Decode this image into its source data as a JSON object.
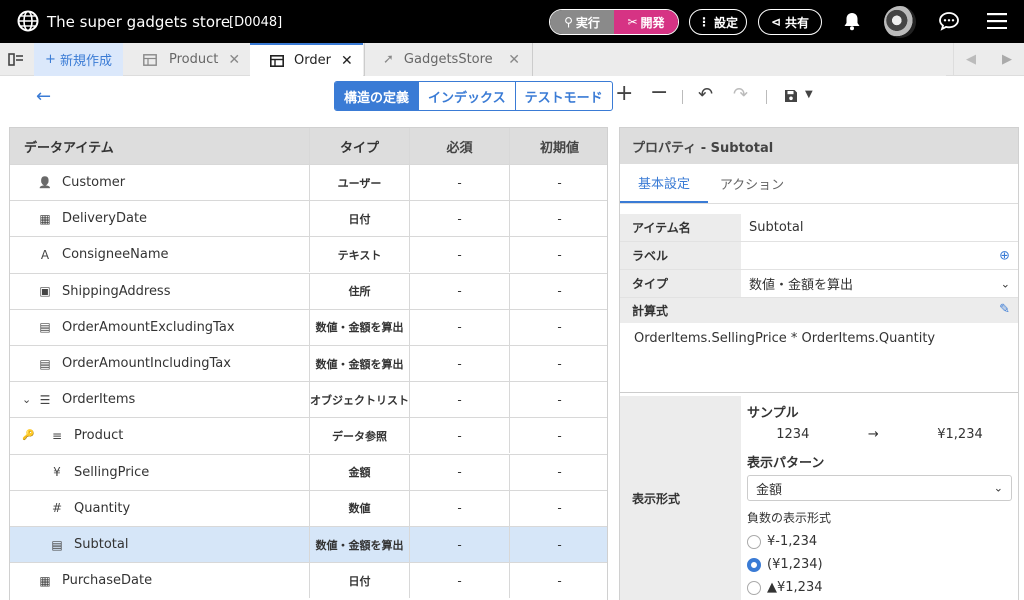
{
  "app": {
    "title": "The super gadgets store",
    "id": "[D0048]"
  },
  "header": {
    "run_label": "実行",
    "dev_label": "開発",
    "settings_label": "設定",
    "share_label": "共有"
  },
  "tabs": {
    "new_label": "新規作成",
    "items": [
      {
        "label": "Product",
        "active": false
      },
      {
        "label": "Order",
        "active": true
      },
      {
        "label": "GadgetsStore",
        "active": false
      }
    ]
  },
  "toolbar": {
    "segments": [
      "構造の定義",
      "インデックス",
      "テストモード"
    ],
    "active_segment": "構造の定義"
  },
  "grid": {
    "columns": [
      "データアイテム",
      "タイプ",
      "必須",
      "初期値"
    ],
    "rows": [
      {
        "name": "Customer",
        "type": "ユーザー",
        "required": "-",
        "default": "-",
        "icon": "user-icon",
        "level": 0
      },
      {
        "name": "DeliveryDate",
        "type": "日付",
        "required": "-",
        "default": "-",
        "icon": "calendar-icon",
        "level": 0
      },
      {
        "name": "ConsigneeName",
        "type": "テキスト",
        "required": "-",
        "default": "-",
        "icon": "text-icon",
        "level": 0
      },
      {
        "name": "ShippingAddress",
        "type": "住所",
        "required": "-",
        "default": "-",
        "icon": "address-icon",
        "level": 0
      },
      {
        "name": "OrderAmountExcludingTax",
        "type": "数値・金額を算出",
        "required": "-",
        "default": "-",
        "icon": "calculator-icon",
        "level": 0
      },
      {
        "name": "OrderAmountIncludingTax",
        "type": "数値・金額を算出",
        "required": "-",
        "default": "-",
        "icon": "calculator-icon",
        "level": 0
      },
      {
        "name": "OrderItems",
        "type": "オブジェクトリスト",
        "required": "-",
        "default": "-",
        "icon": "list-icon",
        "level": 0,
        "expanded": true
      },
      {
        "name": "Product",
        "type": "データ参照",
        "required": "-",
        "default": "-",
        "icon": "database-icon",
        "level": 1,
        "key": true
      },
      {
        "name": "SellingPrice",
        "type": "金額",
        "required": "-",
        "default": "-",
        "icon": "yen-icon",
        "level": 1
      },
      {
        "name": "Quantity",
        "type": "数値",
        "required": "-",
        "default": "-",
        "icon": "hash-icon",
        "level": 1
      },
      {
        "name": "Subtotal",
        "type": "数値・金額を算出",
        "required": "-",
        "default": "-",
        "icon": "calculator-icon",
        "level": 1,
        "selected": true
      },
      {
        "name": "PurchaseDate",
        "type": "日付",
        "required": "-",
        "default": "-",
        "icon": "calendar-icon",
        "level": 0
      }
    ]
  },
  "props": {
    "title": "プロパティ - Subtotal",
    "tabs": [
      "基本設定",
      "アクション"
    ],
    "item_name_label": "アイテム名",
    "item_name_value": "Subtotal",
    "label_label": "ラベル",
    "label_value": "",
    "type_label": "タイプ",
    "type_value": "数値・金額を算出",
    "formula_label": "計算式",
    "formula_value": "OrderItems.SellingPrice * OrderItems.Quantity",
    "format_label": "表示形式",
    "sample_title": "サンプル",
    "sample_input": "1234",
    "sample_arrow": "→",
    "sample_output": "¥1,234",
    "pattern_title": "表示パターン",
    "pattern_value": "金額",
    "neg_title": "負数の表示形式",
    "neg_options": [
      "¥-1,234",
      "(¥1,234)",
      "▲¥1,234"
    ],
    "neg_selected": 1
  },
  "colors": {
    "accent": "#3a7bd5",
    "dev": "#d63384",
    "run": "#8a8a8a",
    "selected_row": "#d6e6f8"
  }
}
